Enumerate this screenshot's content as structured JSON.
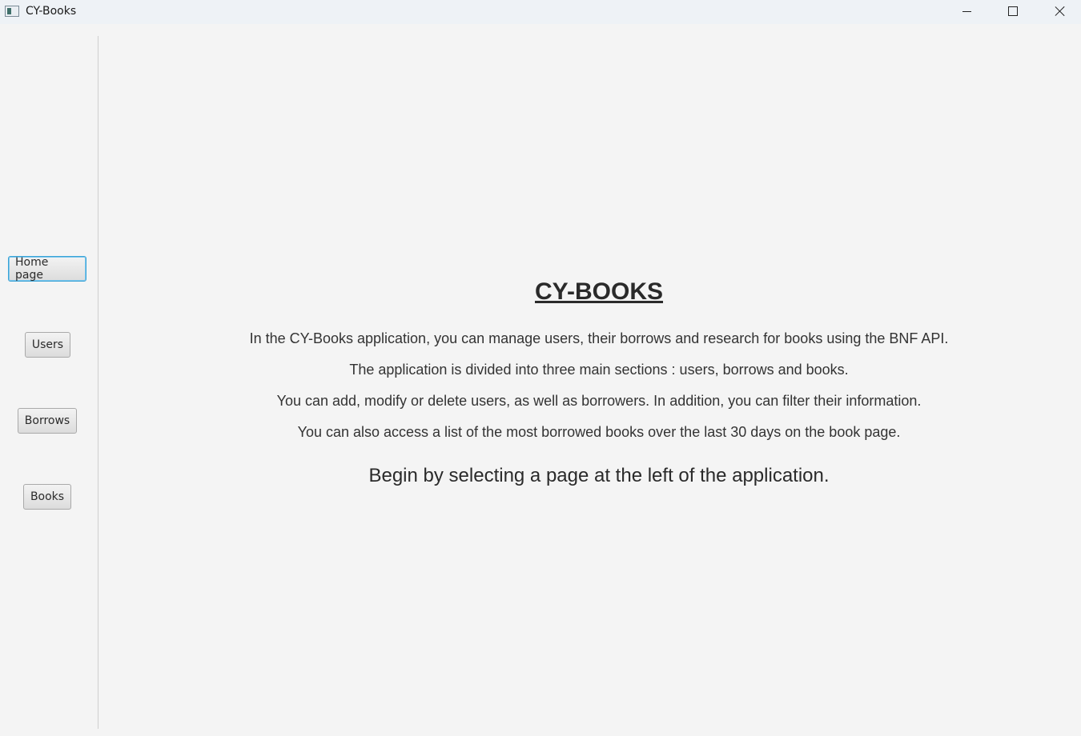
{
  "window": {
    "title": "CY-Books",
    "icon": "app-window-icon",
    "controls": {
      "minimize_icon": "minimize-icon",
      "maximize_icon": "maximize-icon",
      "close_icon": "close-icon"
    }
  },
  "sidebar": {
    "items": [
      {
        "label": "Home page",
        "selected": true
      },
      {
        "label": "Users"
      },
      {
        "label": "Borrows"
      },
      {
        "label": "Books"
      }
    ]
  },
  "main": {
    "title": "CY-BOOKS",
    "paragraphs": [
      "In the CY-Books application, you can manage users, their borrows and research for books using the BNF API.",
      "The application is divided into three main sections : users, borrows and books.",
      "You can add, modify or delete users, as well as borrowers. In addition, you can filter their information.",
      "You can also access a list of the most borrowed books over the last 30 days on the book page."
    ],
    "call_to_action": "Begin by selecting a page at the left of the application."
  },
  "colors": {
    "background": "#f4f4f4",
    "focus_border": "#3aa3d6",
    "text": "#333333"
  }
}
